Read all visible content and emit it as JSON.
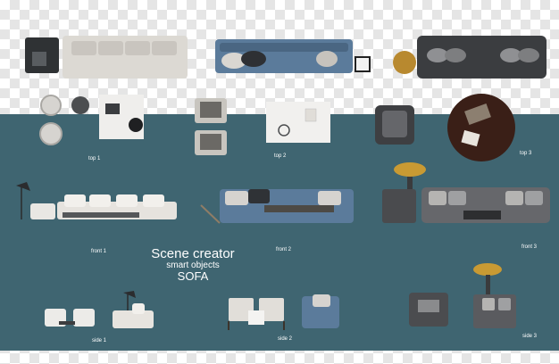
{
  "title": {
    "line1": "Scene creator",
    "line2": "smart objects",
    "line3": "SOFA"
  },
  "views": {
    "top1": "top 1",
    "top2": "top 2",
    "top3": "top 3",
    "front1": "front 1",
    "front2": "front 2",
    "front3": "front 3",
    "side1": "side 1",
    "side2": "side 2",
    "side3": "side 3"
  },
  "colors": {
    "panel": "#3f6571",
    "sofa_white": "#e4e1dc",
    "sofa_blue": "#5b7b9b",
    "sofa_gray": "#55575a"
  }
}
